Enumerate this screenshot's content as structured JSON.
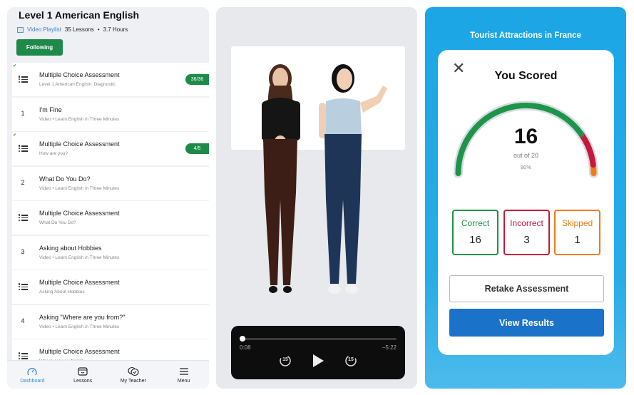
{
  "playlist": {
    "title": "Level 1 American English",
    "type_label": "Video Playlist",
    "lessons": "35 Lessons",
    "separator": "•",
    "hours": "3.7 Hours",
    "follow_label": "Following",
    "items": [
      {
        "kind": "assessment",
        "title": "Multiple Choice Assessment",
        "subtitle": "Level 1 American English: Diagnostic",
        "badge": "36/36",
        "done": true
      },
      {
        "kind": "video",
        "num": "1",
        "title": "I'm Fine",
        "subtitle": "Video • Learn English in Three Minutes"
      },
      {
        "kind": "assessment",
        "title": "Multiple Choice Assessment",
        "subtitle": "How are you?",
        "badge": "4/5",
        "done": true
      },
      {
        "kind": "video",
        "num": "2",
        "title": "What Do You Do?",
        "subtitle": "Video • Learn English in Three Minutes"
      },
      {
        "kind": "assessment",
        "title": "Multiple Choice Assessment",
        "subtitle": "What Do You Do?"
      },
      {
        "kind": "video",
        "num": "3",
        "title": "Asking about Hobbies",
        "subtitle": "Video • Learn English in Three Minutes"
      },
      {
        "kind": "assessment",
        "title": "Multiple Choice Assessment",
        "subtitle": "Asking About Hobbies"
      },
      {
        "kind": "video",
        "num": "4",
        "title": "Asking \"Where are you from?\"",
        "subtitle": "Video • Learn English in Three Minutes"
      },
      {
        "kind": "assessment",
        "title": "Multiple Choice Assessment",
        "subtitle": "Where are you from?"
      }
    ],
    "nav": [
      {
        "label": "Dashboard",
        "icon": "dashboard-icon",
        "active": true
      },
      {
        "label": "Lessons",
        "icon": "lessons-icon"
      },
      {
        "label": "My Teacher",
        "icon": "chat-icon"
      },
      {
        "label": "Menu",
        "icon": "menu-icon"
      }
    ]
  },
  "player": {
    "elapsed": "0:08",
    "remaining": "−5:22",
    "progress_fraction": 0.02,
    "skip_back_label": "15",
    "skip_forward_label": "15"
  },
  "score": {
    "lesson_title": "Tourist Attractions in France",
    "heading": "You Scored",
    "score": "16",
    "out_of": "out of 20",
    "percent": "80%",
    "correct_label": "Correct",
    "correct": "16",
    "incorrect_label": "Incorrect",
    "incorrect": "3",
    "skipped_label": "Skipped",
    "skipped": "1",
    "retake_label": "Retake Assessment",
    "view_label": "View Results",
    "colors": {
      "correct": "#1e9448",
      "incorrect": "#c8163c",
      "skipped": "#f07c12",
      "accent": "#1a73c8"
    }
  }
}
